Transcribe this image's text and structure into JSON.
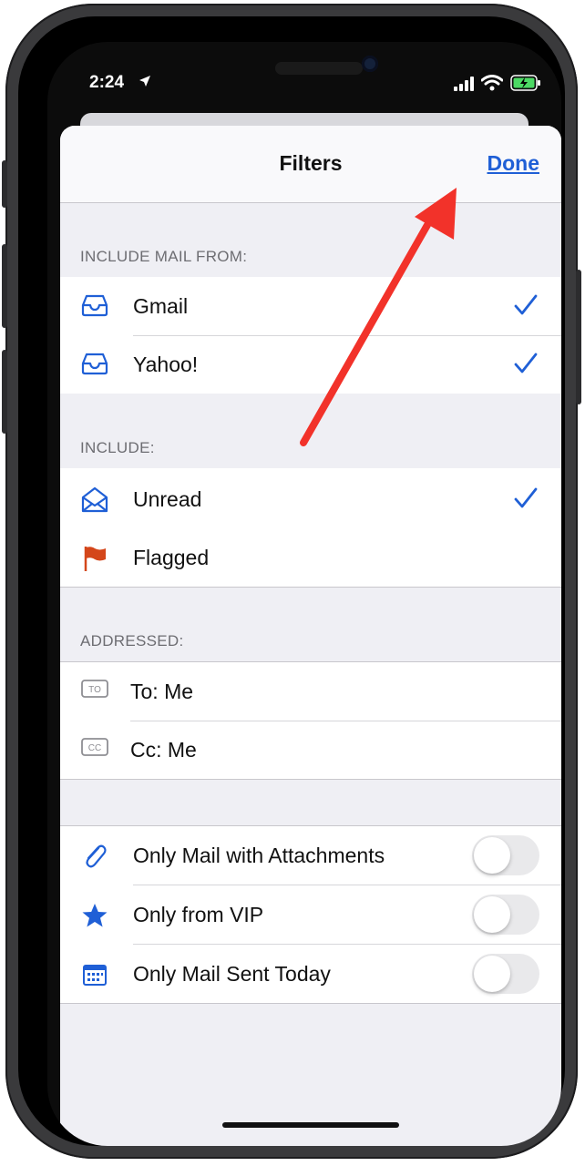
{
  "status_bar": {
    "time": "2:24"
  },
  "navbar": {
    "title": "Filters",
    "done_label": "Done"
  },
  "include_mail_from": {
    "header": "INCLUDE MAIL FROM:",
    "items": [
      {
        "label": "Gmail",
        "icon": "inbox-tray-icon",
        "checked": true
      },
      {
        "label": "Yahoo!",
        "icon": "inbox-tray-icon",
        "checked": true
      }
    ]
  },
  "include": {
    "header": "INCLUDE:",
    "items": [
      {
        "label": "Unread",
        "icon": "envelope-open-icon",
        "checked": true
      },
      {
        "label": "Flagged",
        "icon": "flag-icon",
        "checked": false
      }
    ]
  },
  "addressed": {
    "header": "ADDRESSED:",
    "items": [
      {
        "label": "To: Me",
        "badge": "TO",
        "icon": "to-badge-icon"
      },
      {
        "label": "Cc: Me",
        "badge": "CC",
        "icon": "cc-badge-icon"
      }
    ]
  },
  "options": {
    "items": [
      {
        "label": "Only Mail with Attachments",
        "icon": "paperclip-icon",
        "on": false
      },
      {
        "label": "Only from VIP",
        "icon": "star-icon",
        "on": false
      },
      {
        "label": "Only Mail Sent Today",
        "icon": "calendar-icon",
        "on": false
      }
    ]
  },
  "colors": {
    "accent": "#1f5fd6",
    "flag": "#d4461a",
    "arrow": "#f2322a",
    "background": "#efeff4"
  }
}
